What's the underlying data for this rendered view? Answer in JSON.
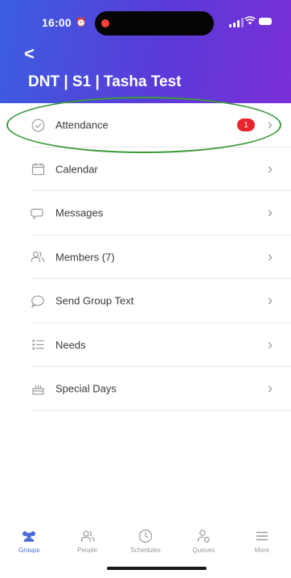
{
  "status_bar": {
    "time": "16:00"
  },
  "header": {
    "back_label": "<",
    "title": "DNT | S1 | Tasha Test"
  },
  "menu": {
    "items": [
      {
        "label": "Attendance",
        "icon": "check-circle-icon",
        "badge": "1"
      },
      {
        "label": "Calendar",
        "icon": "calendar-icon"
      },
      {
        "label": "Messages",
        "icon": "chat-bubble-icon"
      },
      {
        "label": "Members (7)",
        "icon": "members-icon"
      },
      {
        "label": "Send Group Text",
        "icon": "message-icon"
      },
      {
        "label": "Needs",
        "icon": "list-icon"
      },
      {
        "label": "Special Days",
        "icon": "cake-icon"
      }
    ]
  },
  "tabbar": {
    "items": [
      {
        "label": "Groups",
        "icon": "groups-icon",
        "active": true
      },
      {
        "label": "People",
        "icon": "people-icon"
      },
      {
        "label": "Schedules",
        "icon": "clock-icon"
      },
      {
        "label": "Queues",
        "icon": "queue-person-icon"
      },
      {
        "label": "More",
        "icon": "menu-icon"
      }
    ]
  },
  "colors": {
    "header_gradient_start": "#3b5fe0",
    "header_gradient_end": "#7a2fd6",
    "badge": "#e8242c",
    "active_tab": "#4b6bd6",
    "highlight_ellipse": "#3a9a3a"
  }
}
